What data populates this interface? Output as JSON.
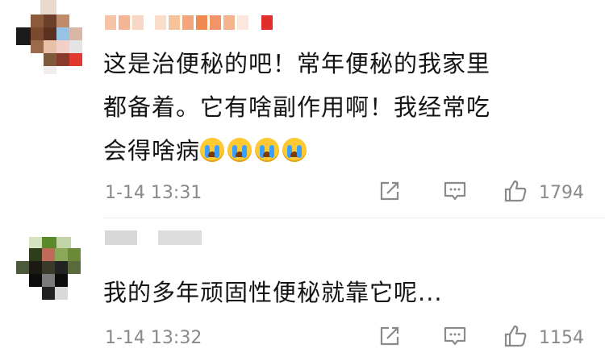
{
  "comments": [
    {
      "text_line1": "这是治便秘的吧！常年便秘的我家里",
      "text_line2": "都备着。它有啥副作用啊！我经常吃",
      "text_line3": "会得啥病",
      "emoji": "crying-face-icon",
      "time": "1-14 13:31",
      "likes": "1794"
    },
    {
      "text_line1": "我的多年顽固性便秘就靠它呢...",
      "time": "1-14 13:32",
      "likes": "1154"
    }
  ],
  "colors": {
    "meta_gray": "#8a8a8a",
    "text": "#141414",
    "emoji_yellow": "#ffc933",
    "tear_blue": "#3aa0ff"
  }
}
